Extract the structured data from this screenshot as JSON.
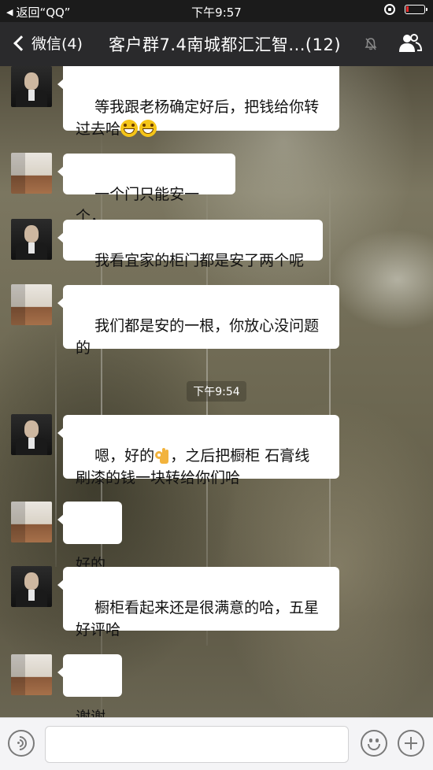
{
  "status_bar": {
    "back_app": "返回“QQ”",
    "time": "下午9:57"
  },
  "nav": {
    "back_label": "微信(4)",
    "title": "客户群7.4南城都汇汇智...(12)"
  },
  "timestamp": "下午9:54",
  "messages": [
    {
      "sender": "man",
      "text": "等我跟老杨确定好后，把钱给你转\n过去哈",
      "emoji_after": 2
    },
    {
      "sender": "room",
      "text": "一个门只能安一个，"
    },
    {
      "sender": "man",
      "text": "我看宜家的柜门都是安了两个呢"
    },
    {
      "sender": "room",
      "text": "我们都是安的一根，你放心没问题\n的"
    },
    {
      "sender": "man",
      "text_a": "嗯，好的",
      "text_b": "，之后把橱柜 石膏线\n刷漆的钱一块转给你们哈"
    },
    {
      "sender": "room",
      "text": "好的"
    },
    {
      "sender": "man",
      "text": "橱柜看起来还是很满意的哈，五星\n好评哈"
    },
    {
      "sender": "room",
      "text": "谢谢"
    }
  ],
  "input": {
    "value": "",
    "placeholder": ""
  },
  "colors": {
    "status_bg": "#1b1b1b",
    "nav_bg": "#2a2a2c",
    "bubble": "#ffffff",
    "battery_low": "#e52b2b"
  }
}
